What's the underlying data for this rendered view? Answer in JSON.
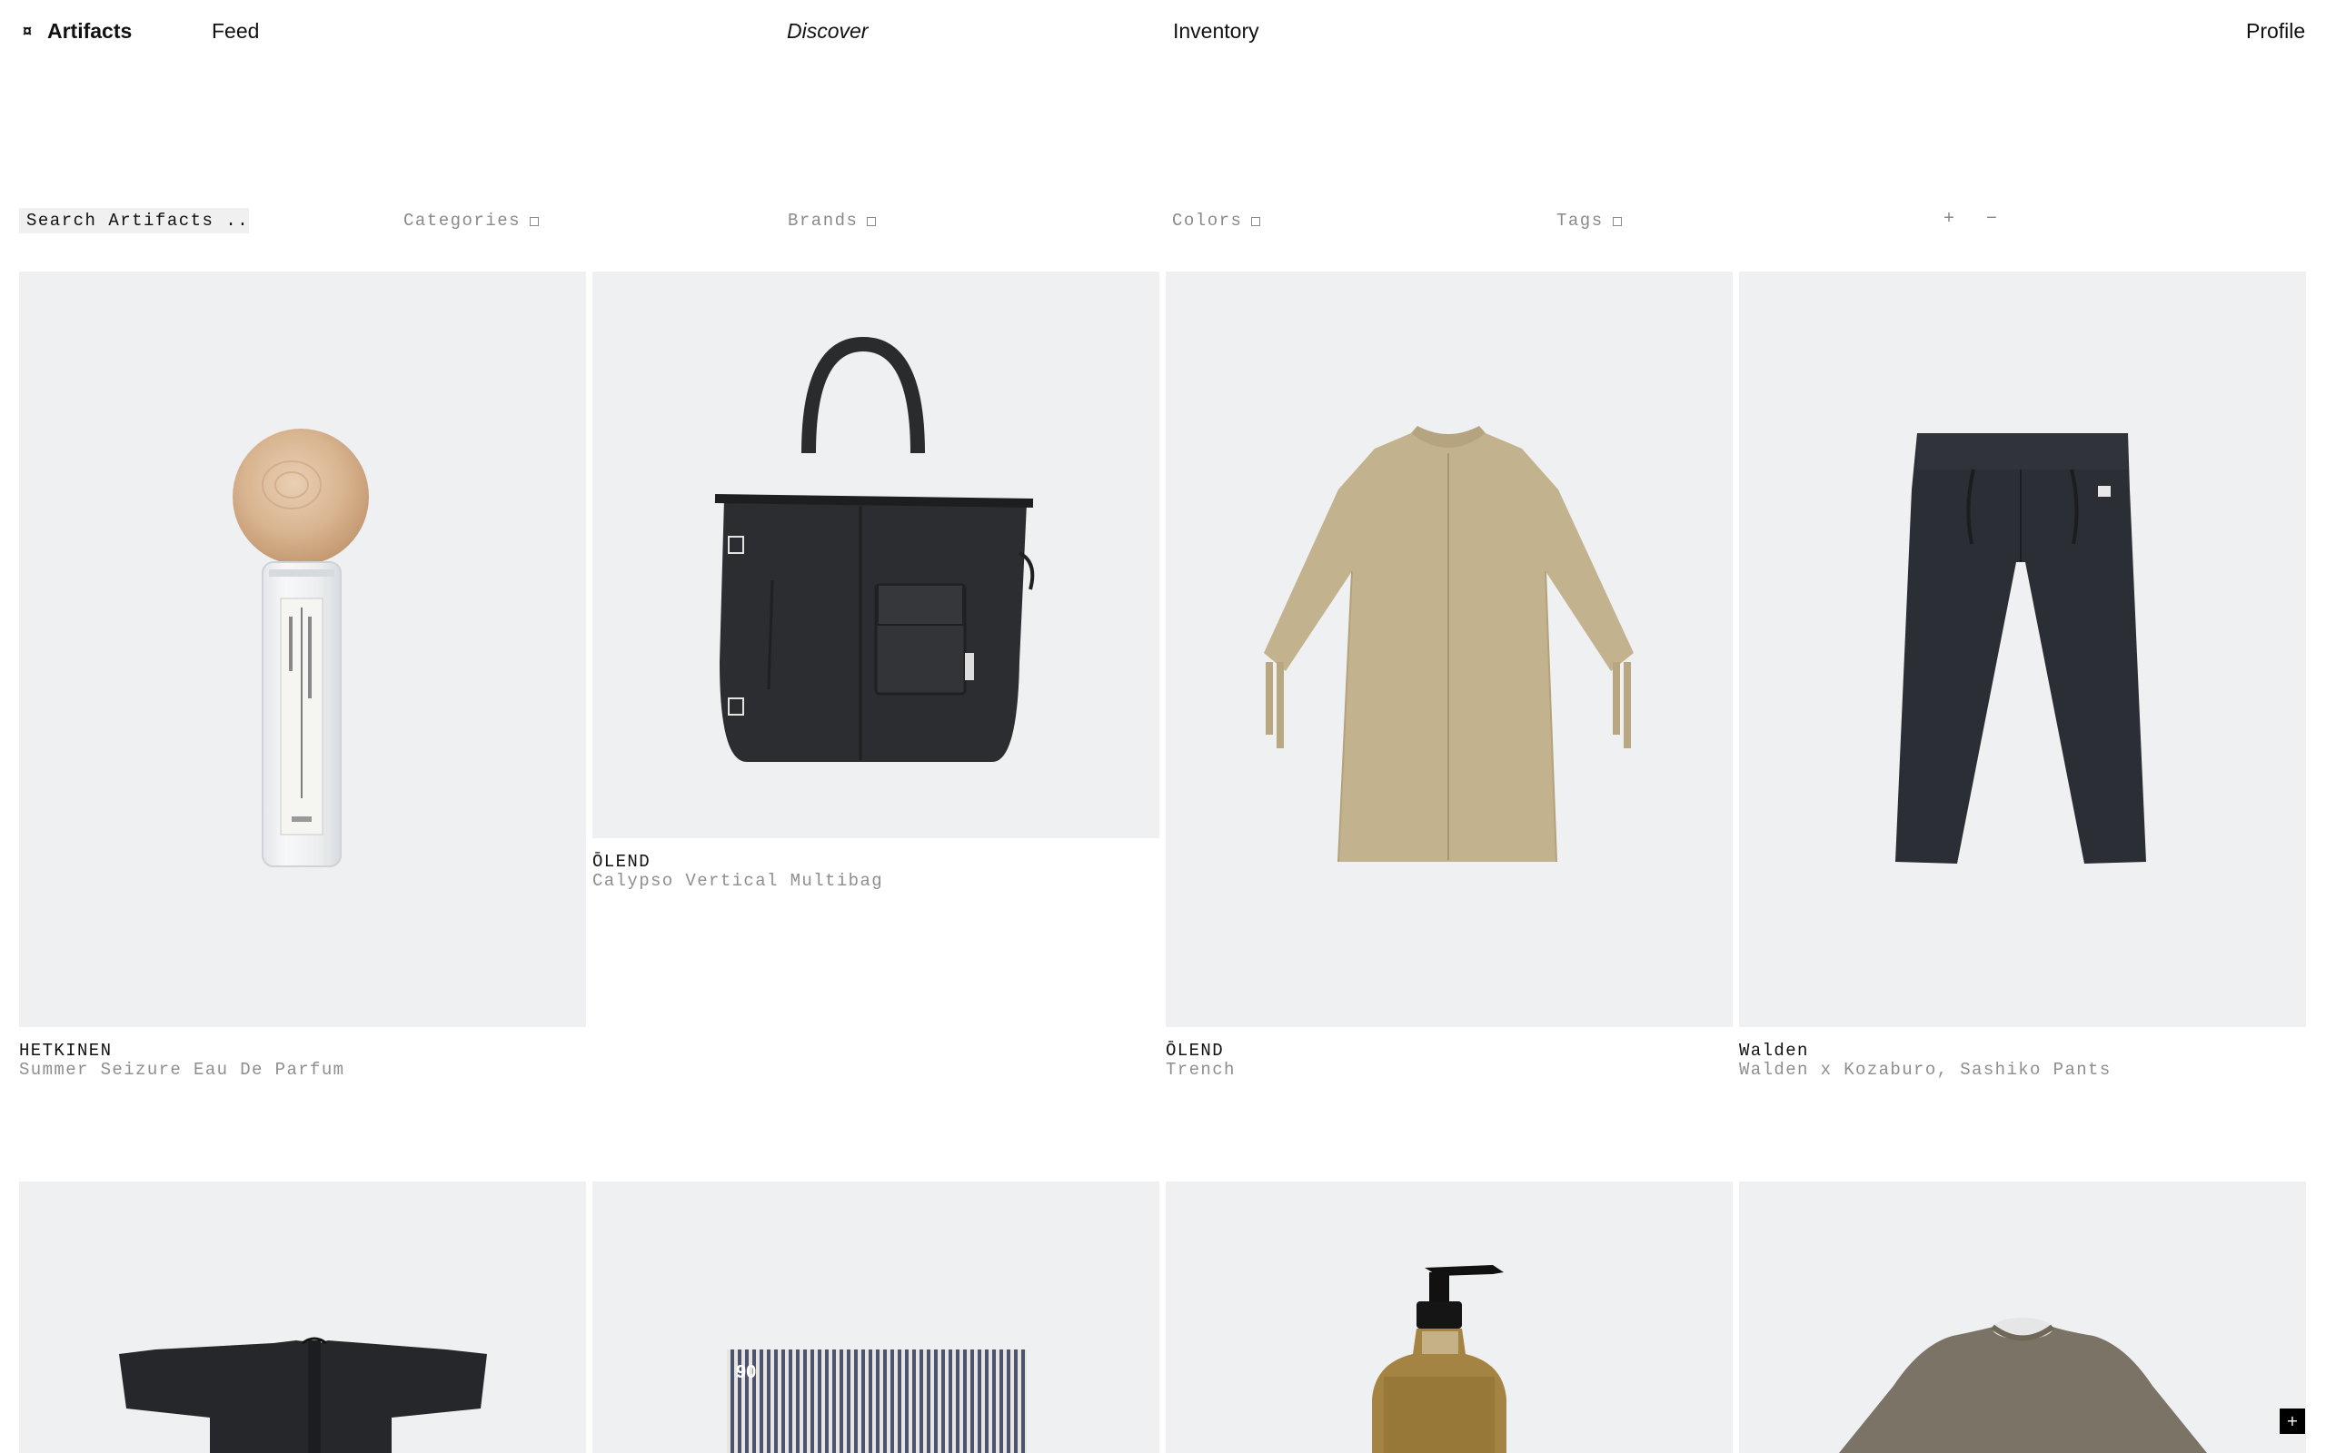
{
  "nav": {
    "logo": "Artifacts",
    "feed": "Feed",
    "discover": "Discover",
    "inventory": "Inventory",
    "profile": "Profile"
  },
  "filters": {
    "search_placeholder": "Search Artifacts ...",
    "categories": "Categories",
    "brands": "Brands",
    "colors": "Colors",
    "tags": "Tags",
    "zoom_in": "+",
    "zoom_out": "−"
  },
  "products": [
    {
      "brand": "HETKINEN",
      "name": "Summer Seizure Eau De Parfum",
      "icon": "perfume-bottle-image"
    },
    {
      "brand": "ŌLEND",
      "name": "Calypso Vertical Multibag",
      "icon": "tote-bag-image"
    },
    {
      "brand": "ŌLEND",
      "name": "Trench",
      "icon": "trench-coat-image"
    },
    {
      "brand": "Walden",
      "name": "Walden x Kozaburo, Sashiko Pants",
      "icon": "pants-image"
    },
    {
      "icon": "jacket-image"
    },
    {
      "icon": "striped-fabric-image",
      "badge": "90"
    },
    {
      "icon": "pump-bottle-image"
    },
    {
      "icon": "sweater-image"
    }
  ],
  "fab": "+"
}
